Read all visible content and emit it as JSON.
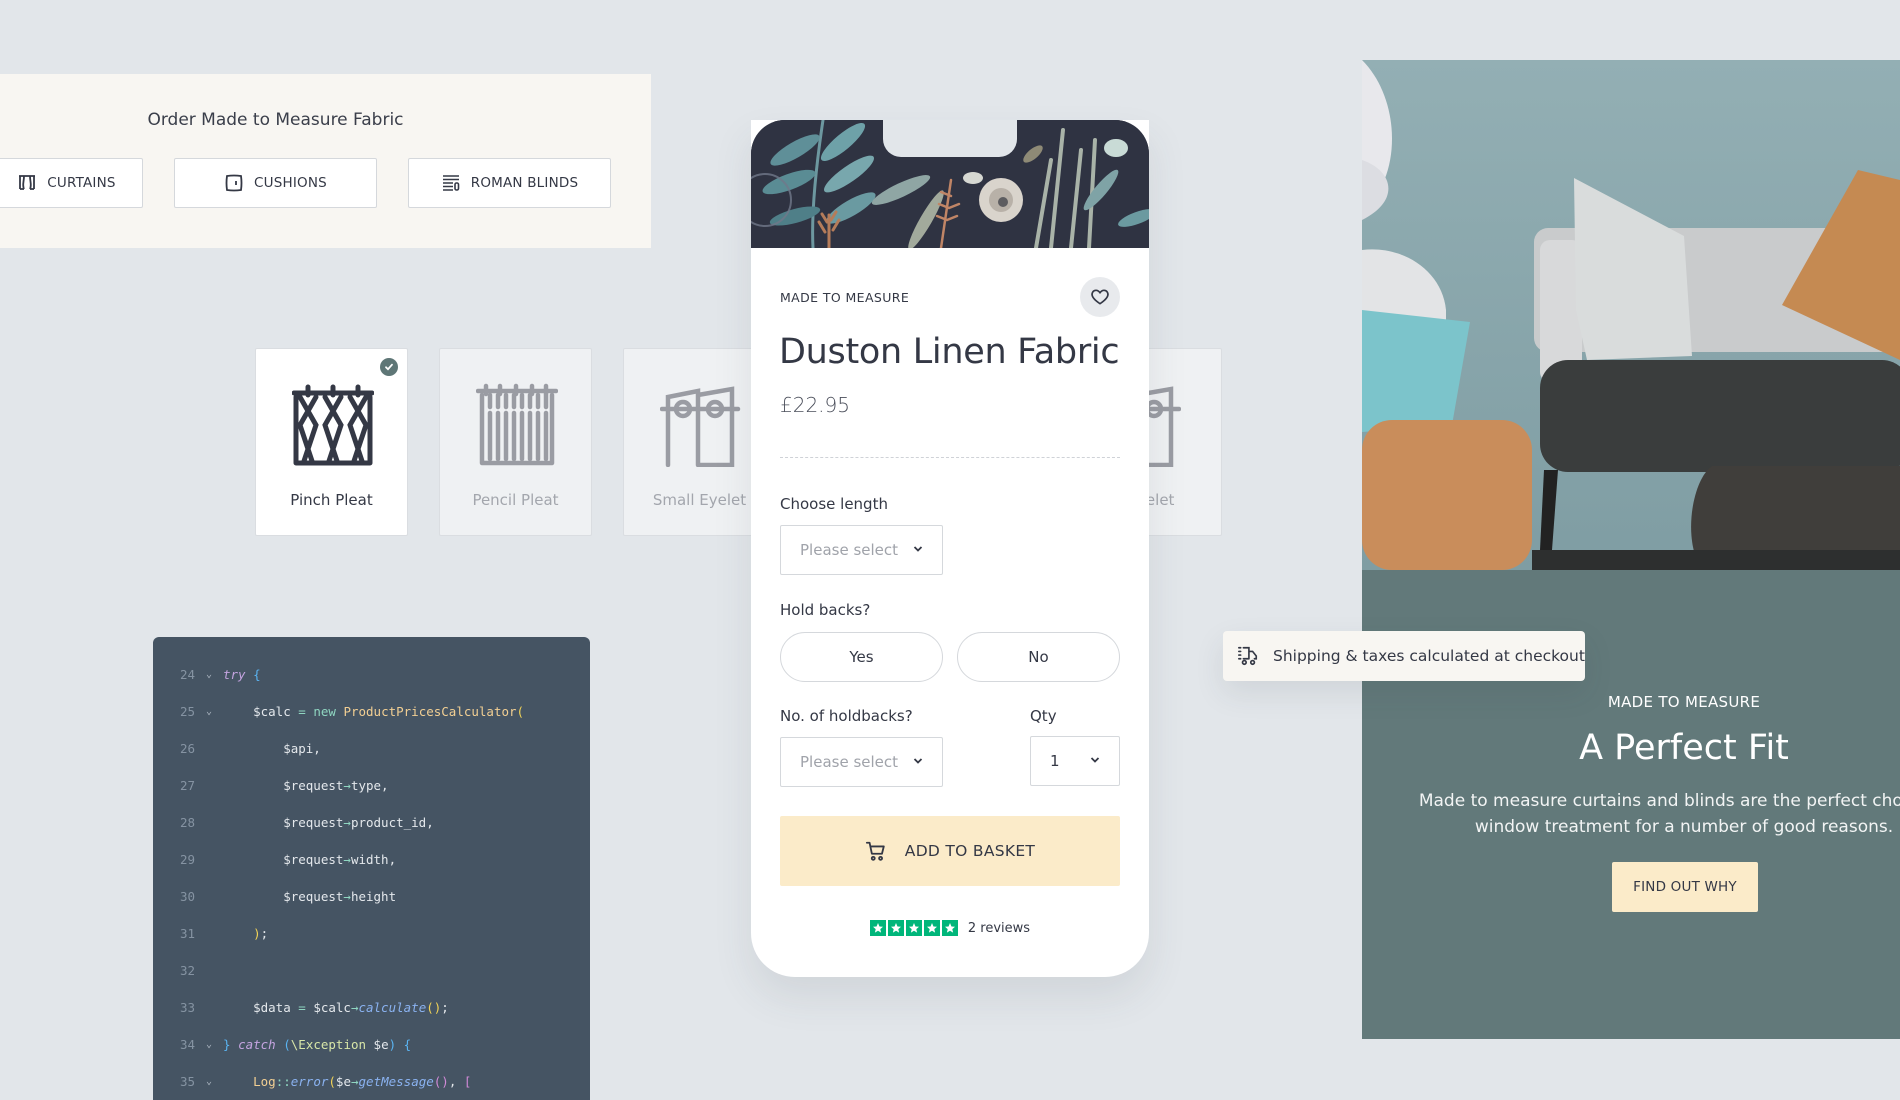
{
  "order_card": {
    "title": "Order Made to Measure Fabric",
    "types": [
      {
        "label": "CURTAINS",
        "icon": "curtains-icon"
      },
      {
        "label": "CUSHIONS",
        "icon": "cushion-icon"
      },
      {
        "label": "ROMAN BLINDS",
        "icon": "roman-blind-icon"
      }
    ]
  },
  "headings": [
    {
      "label": "Pinch Pleat",
      "selected": true,
      "icon": "pinch-pleat-icon"
    },
    {
      "label": "Pencil Pleat",
      "selected": false,
      "icon": "pencil-pleat-icon"
    },
    {
      "label": "Small Eyelet",
      "selected": false,
      "icon": "small-eyelet-icon"
    },
    {
      "label": "Eyelet",
      "selected": false,
      "icon": "eyelet-icon"
    }
  ],
  "code": {
    "lines": [
      {
        "n": "24",
        "fold": true
      },
      {
        "n": "25",
        "fold": true
      },
      {
        "n": "26",
        "fold": false
      },
      {
        "n": "27",
        "fold": false
      },
      {
        "n": "28",
        "fold": false
      },
      {
        "n": "29",
        "fold": false
      },
      {
        "n": "30",
        "fold": false
      },
      {
        "n": "31",
        "fold": false
      },
      {
        "n": "32",
        "fold": false
      },
      {
        "n": "33",
        "fold": false
      },
      {
        "n": "34",
        "fold": true
      },
      {
        "n": "35",
        "fold": true
      }
    ],
    "tokens": {
      "l24": [
        [
          "kw",
          "try"
        ],
        [
          "t",
          " "
        ],
        [
          "brace",
          "{"
        ]
      ],
      "l25": [
        [
          "t",
          "    $calc "
        ],
        [
          "op",
          "="
        ],
        [
          "t",
          " "
        ],
        [
          "new",
          "new"
        ],
        [
          "t",
          " "
        ],
        [
          "cls",
          "ProductPricesCalculator"
        ],
        [
          "paren",
          "("
        ]
      ],
      "l26": [
        [
          "t",
          "        $api,"
        ]
      ],
      "l27": [
        [
          "t",
          "        $request"
        ],
        [
          "op",
          "→"
        ],
        [
          "t",
          "type,"
        ]
      ],
      "l28": [
        [
          "t",
          "        $request"
        ],
        [
          "op",
          "→"
        ],
        [
          "t",
          "product_id,"
        ]
      ],
      "l29": [
        [
          "t",
          "        $request"
        ],
        [
          "op",
          "→"
        ],
        [
          "t",
          "width,"
        ]
      ],
      "l30": [
        [
          "t",
          "        $request"
        ],
        [
          "op",
          "→"
        ],
        [
          "t",
          "height"
        ]
      ],
      "l31": [
        [
          "t",
          "    "
        ],
        [
          "paren",
          ")"
        ],
        [
          "t",
          ";"
        ]
      ],
      "l32": [],
      "l33": [
        [
          "t",
          "    $data "
        ],
        [
          "op",
          "="
        ],
        [
          "t",
          " $calc"
        ],
        [
          "op",
          "→"
        ],
        [
          "fn",
          "calculate"
        ],
        [
          "paren",
          "()"
        ],
        [
          "t",
          ";"
        ]
      ],
      "l34": [
        [
          "brace",
          "}"
        ],
        [
          "t",
          " "
        ],
        [
          "kw",
          "catch"
        ],
        [
          "t",
          " "
        ],
        [
          "brace",
          "("
        ],
        [
          "exc",
          "\\Exception"
        ],
        [
          "t",
          " $e"
        ],
        [
          "brace",
          ")"
        ],
        [
          "t",
          " "
        ],
        [
          "brace",
          "{"
        ]
      ],
      "l35": [
        [
          "t",
          "    "
        ],
        [
          "cls",
          "Log"
        ],
        [
          "op",
          "::"
        ],
        [
          "fn",
          "error"
        ],
        [
          "paren",
          "("
        ],
        [
          "t",
          "$e"
        ],
        [
          "op",
          "→"
        ],
        [
          "fn",
          "getMessage"
        ],
        [
          "bracket",
          "()"
        ],
        [
          "t",
          ", "
        ],
        [
          "bracket",
          "["
        ]
      ]
    }
  },
  "product": {
    "eyebrow": "MADE TO MEASURE",
    "title": "Duston Linen Fabric",
    "price": "£22.95",
    "wishlist_icon": "heart-icon",
    "choose_length_label": "Choose length",
    "choose_length_value": "Please select",
    "holdbacks_label": "Hold backs?",
    "holdbacks_yes": "Yes",
    "holdbacks_no": "No",
    "num_holdbacks_label": "No. of holdbacks?",
    "num_holdbacks_value": "Please select",
    "qty_label": "Qty",
    "qty_value": "1",
    "add_to_basket": "ADD TO BASKET",
    "rating_stars": 5,
    "reviews": "2 reviews"
  },
  "shipping": {
    "text": "Shipping & taxes calculated at checkout",
    "icon": "delivery-truck-icon"
  },
  "hero": {
    "eyebrow": "MADE TO MEASURE",
    "title": "A Perfect Fit",
    "body_line1": "Made to measure curtains and blinds are the perfect choice of",
    "body_line2": "window treatment for a number of good reasons.",
    "cta": "FIND OUT WHY"
  },
  "colors": {
    "background": "#e2e6ea",
    "accent_cream": "#fbebc9",
    "panel_green": "#62797a",
    "card_cream": "#f8f6f2",
    "code_bg": "#455463",
    "trustpilot_green": "#00b67a",
    "check_badge": "#5e7676"
  }
}
